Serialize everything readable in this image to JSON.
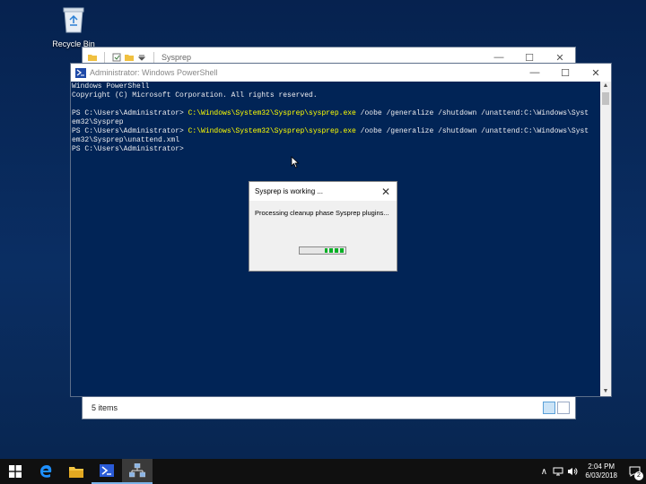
{
  "desktop": {
    "icons": [
      {
        "label": "Recycle Bin",
        "icon": "recycle-bin-icon"
      }
    ]
  },
  "explorer": {
    "title": "Sysprep",
    "status": "5 items",
    "window_controls": {
      "minimize": "—",
      "maximize": "☐",
      "close": "✕"
    }
  },
  "powershell": {
    "title": "Administrator: Windows PowerShell",
    "window_controls": {
      "minimize": "—",
      "maximize": "☐",
      "close": "✕"
    },
    "lines": [
      {
        "text": "Windows PowerShell"
      },
      {
        "text": "Copyright (C) Microsoft Corporation. All rights reserved."
      },
      {
        "text": ""
      },
      {
        "prompt": "PS C:\\Users\\Administrator> ",
        "cmd": "C:\\Windows\\System32\\Sysprep\\sysprep.exe",
        "args": " /oobe /generalize /shutdown /unattend:C:\\Windows\\Syst"
      },
      {
        "text": "em32\\Sysprep"
      },
      {
        "prompt": "PS C:\\Users\\Administrator> ",
        "cmd": "C:\\Windows\\System32\\Sysprep\\sysprep.exe",
        "args": " /oobe /generalize /shutdown /unattend:C:\\Windows\\Syst"
      },
      {
        "text": "em32\\Sysprep\\unattend.xml"
      },
      {
        "text": "PS C:\\Users\\Administrator>"
      }
    ]
  },
  "dialog": {
    "title": "Sysprep is working ...",
    "close": "✕",
    "message": "Processing cleanup phase Sysprep plugins..."
  },
  "taskbar": {
    "clock_time": "2:04 PM",
    "clock_date": "6/03/2018",
    "notification_count": "2",
    "tray_chevron": "∧"
  },
  "colors": {
    "ps_background": "#012456",
    "ps_command": "#ffff00",
    "progress": "#06b025",
    "desktop": "#0a2e63"
  }
}
